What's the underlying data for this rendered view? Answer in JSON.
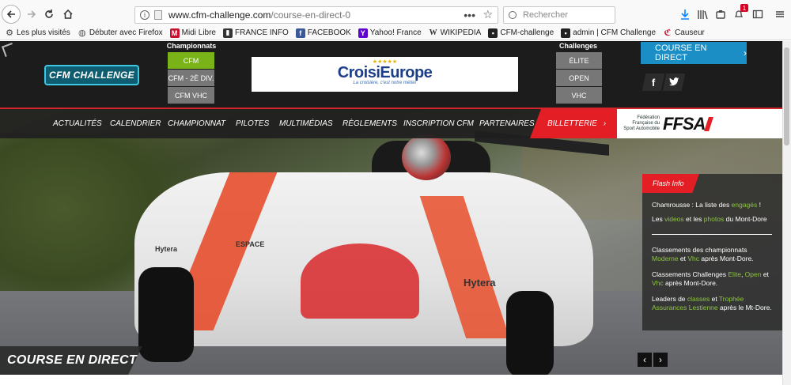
{
  "browser": {
    "url_host": "www.cfm-challenge.com",
    "url_path": "/course-en-direct-0",
    "search_placeholder": "Rechercher",
    "notification_count": "1",
    "icons": {
      "back": "back-arrow-icon",
      "forward": "forward-arrow-icon",
      "reload": "reload-icon",
      "home": "home-icon",
      "download": "download-icon",
      "library": "library-icon",
      "pocket": "pocket-icon",
      "notifications": "bell-icon",
      "sidebar": "sidebar-icon",
      "menu": "hamburger-menu-icon"
    }
  },
  "bookmarks": [
    {
      "label": "Les plus visités",
      "icon": "gear-icon",
      "color": "#444444"
    },
    {
      "label": "Débuter avec Firefox",
      "icon": "globe-icon",
      "color": "#555555"
    },
    {
      "label": "Midi Libre",
      "icon": "midi-libre-icon",
      "color": "#c8102e"
    },
    {
      "label": "FRANCE INFO",
      "icon": "franceinfo-icon",
      "color": "#333333"
    },
    {
      "label": "FACEBOOK",
      "icon": "facebook-icon",
      "color": "#3b5998"
    },
    {
      "label": "Yahoo! France",
      "icon": "yahoo-icon",
      "color": "#5f01d1"
    },
    {
      "label": "WIKIPEDIA",
      "icon": "wikipedia-icon",
      "color": "#777777"
    },
    {
      "label": "CFM-challenge",
      "icon": "cfm-icon",
      "color": "#222222"
    },
    {
      "label": "admin | CFM Challenge",
      "icon": "cfm-admin-icon",
      "color": "#222222"
    },
    {
      "label": "Causeur",
      "icon": "causeur-icon",
      "color": "#c8102e"
    }
  ],
  "site": {
    "logo_text": "CFM CHALLENGE",
    "championnats_title": "Championnats",
    "championnats": [
      "CFM",
      "CFM - 2È DIV.",
      "CFM VHC"
    ],
    "sponsor_brand": "CroisiEurope",
    "sponsor_tagline": "La croisière, c'est notre métier",
    "challenges_title": "Challenges",
    "challenges": [
      "ÉLITE",
      "OPEN",
      "VHC"
    ],
    "live_button": "COURSE EN DIRECT",
    "social": [
      "f",
      "t"
    ],
    "nav": [
      "ACTUALITÉS",
      "CALENDRIER",
      "CHAMPIONNAT",
      "PILOTES",
      "MULTIMÉDIAS",
      "RÈGLEMENTS",
      "INSCRIPTION CFM",
      "PARTENAIRES"
    ],
    "billetterie": "BILLETTERIE",
    "ffsa_small": "Fédération Française du Sport Automobile",
    "ffsa_big": "FFSA",
    "colors": {
      "accent_red": "#e31e24",
      "accent_blue": "#1b8fc5",
      "accent_green": "#8dc63f",
      "cfm_active": "#7ab317"
    }
  },
  "flash": {
    "title": "Flash Info",
    "line1_a": "Chamrousse : La liste des ",
    "line1_b": "engagés",
    "line1_c": " !",
    "line2_a": "Les ",
    "line2_b": "videos",
    "line2_c": " et les ",
    "line2_d": "photos",
    "line2_e": " du Mont-Dore",
    "line3_a": "Classements des championnats ",
    "line3_b": "Moderne",
    "line3_c": " et ",
    "line3_d": "Vhc",
    "line3_e": " après Mont-Dore.",
    "line4_a": "Classements Challenges ",
    "line4_b": "Elite",
    "line4_c": ", ",
    "line4_d": "Open",
    "line4_e": " et ",
    "line4_f": "Vhc",
    "line4_g": " après Mont-Dore.",
    "line5_a": "Leaders de ",
    "line5_b": "classes",
    "line5_c": " et ",
    "line5_d": "Trophée Assurances Lestienne",
    "line5_e": " après le Mt-Dore."
  },
  "hero": {
    "banner": "COURSE EN DIRECT",
    "prev": "‹",
    "next": "›",
    "car_labels": [
      "Hytera",
      "ESPACE",
      "Hytera"
    ]
  }
}
